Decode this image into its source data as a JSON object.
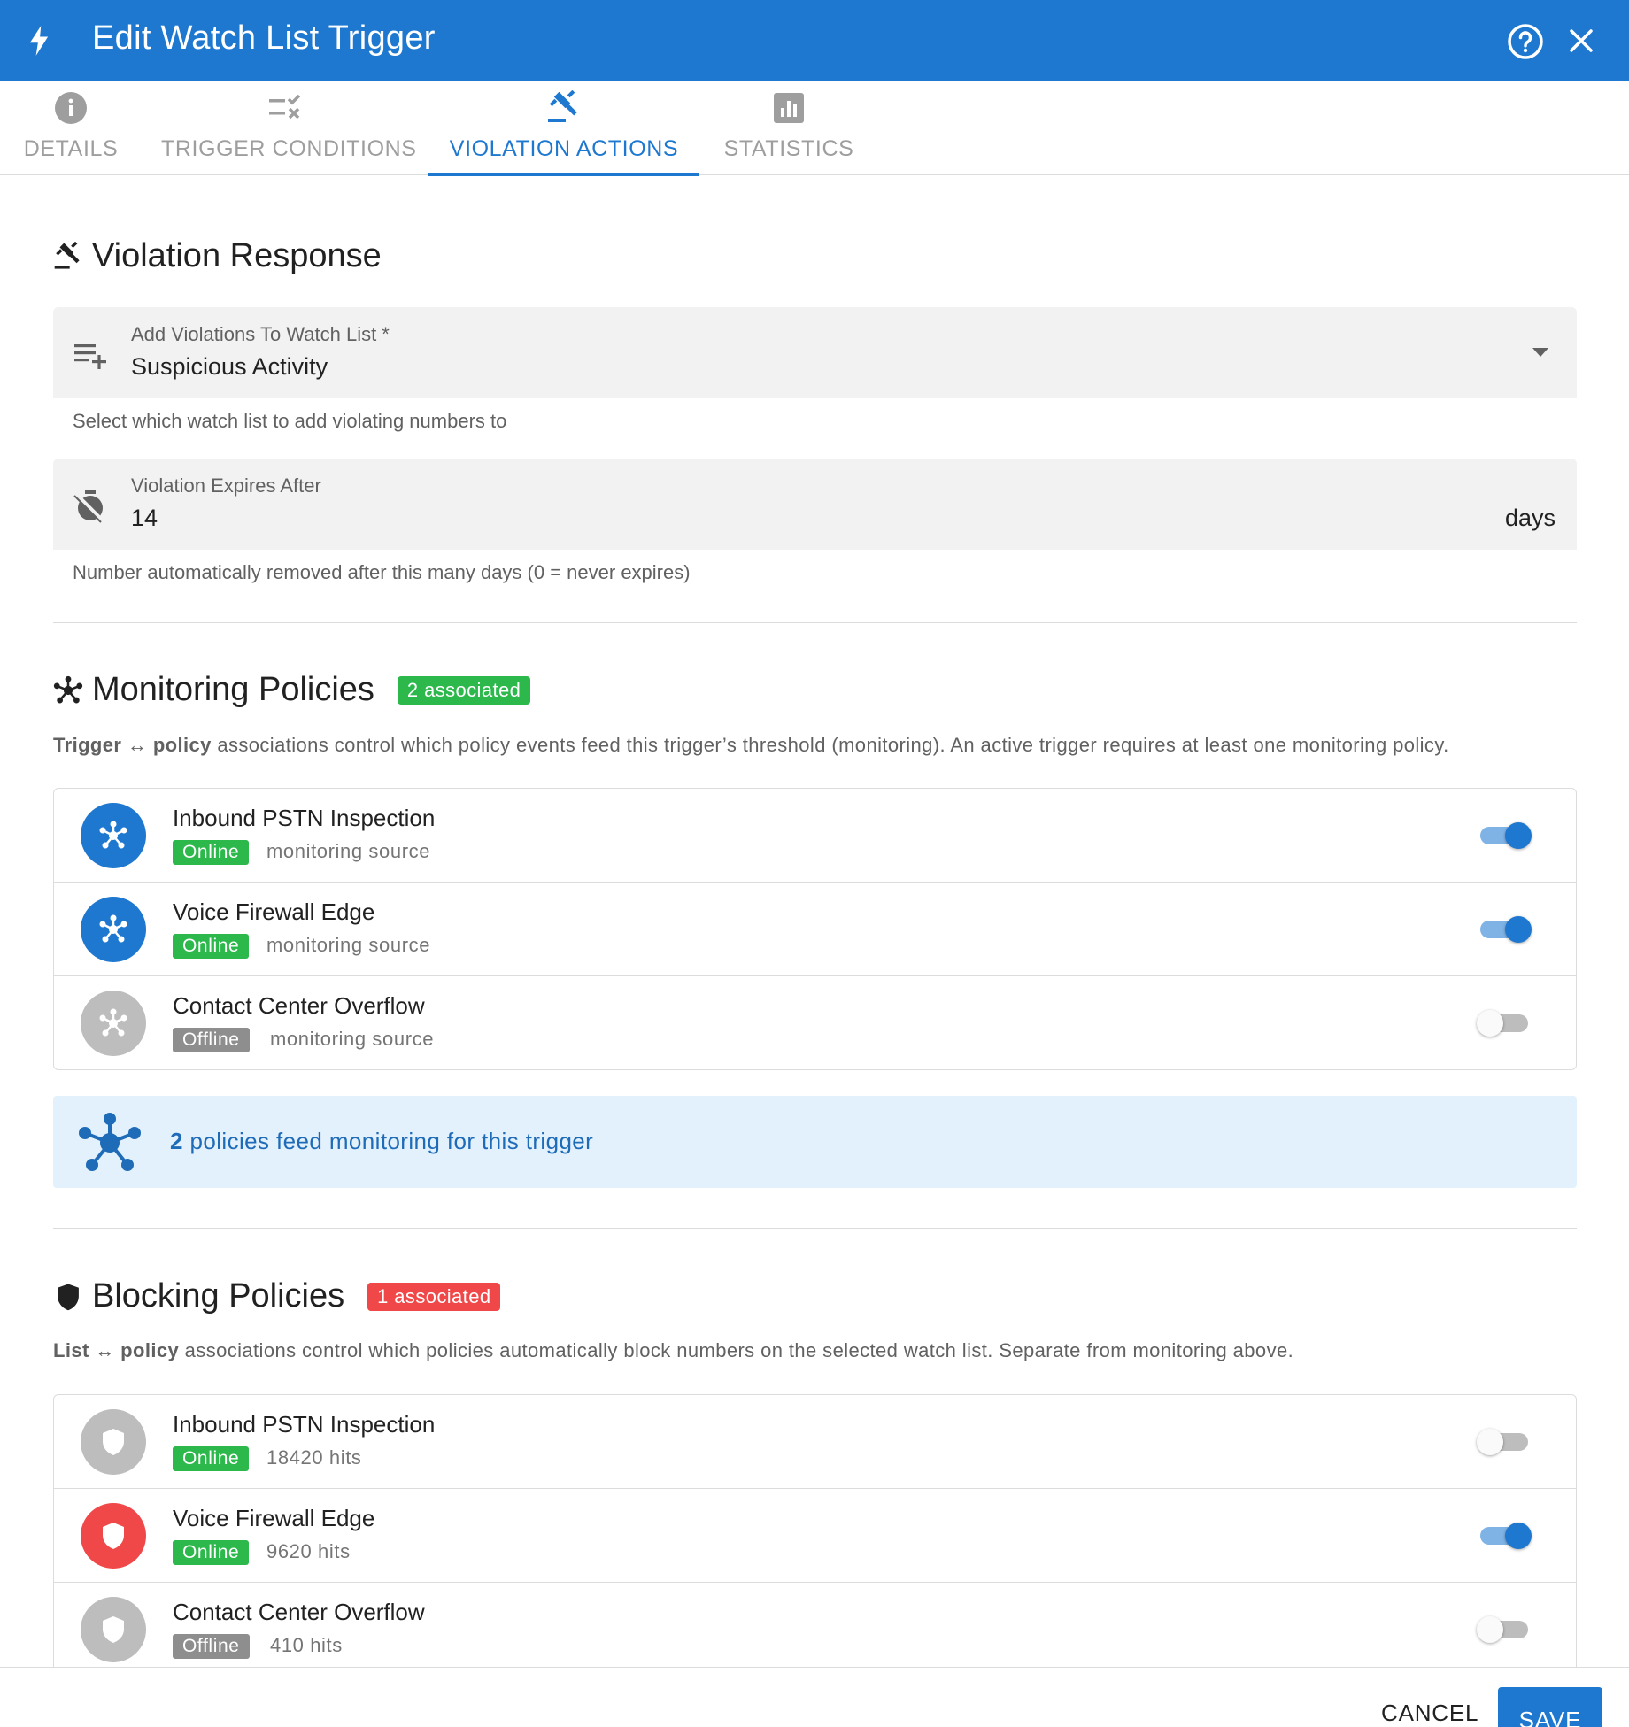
{
  "header": {
    "title": "Edit Watch List Trigger",
    "bg_color": "#1e78d0",
    "icons": {
      "left": "bolt-icon",
      "help": "help-circle-icon",
      "close": "close-icon"
    }
  },
  "tabs": [
    {
      "label": "DETAILS",
      "icon": "info-icon",
      "active": false
    },
    {
      "label": "TRIGGER CONDITIONS",
      "icon": "rule-icon",
      "active": false
    },
    {
      "label": "VIOLATION ACTIONS",
      "icon": "gavel-icon",
      "active": true
    },
    {
      "label": "STATISTICS",
      "icon": "bar-chart-icon",
      "active": false
    }
  ],
  "violation_response": {
    "title": "Violation Response",
    "watch_list_field": {
      "label": "Add Violations To Watch List *",
      "value": "Suspicious Activity",
      "help": "Select which watch list to add violating numbers to"
    },
    "expires_field": {
      "label": "Violation Expires After",
      "value": "14",
      "suffix": "days",
      "help": "Number automatically removed after this many days (0 = never expires)"
    }
  },
  "monitoring": {
    "title": "Monitoring Policies",
    "badge": "2 associated",
    "desc_bold1": "Trigger",
    "desc_arrow": "↔",
    "desc_bold2": "policy",
    "desc_rest": "associations control which policy events feed this trigger’s threshold (monitoring). An active trigger requires at least one monitoring policy.",
    "items": [
      {
        "name": "Inbound PSTN Inspection",
        "status": "Online",
        "sub": "monitoring source",
        "enabled": true
      },
      {
        "name": "Voice Firewall Edge",
        "status": "Online",
        "sub": "monitoring source",
        "enabled": true
      },
      {
        "name": "Contact Center Overflow",
        "status": "Offline",
        "sub": "monitoring source",
        "enabled": false
      }
    ],
    "summary_count": "2",
    "summary_text": "policies feed monitoring for this trigger"
  },
  "blocking": {
    "title": "Blocking Policies",
    "badge": "1 associated",
    "desc_bold1": "List",
    "desc_arrow": "↔",
    "desc_bold2": "policy",
    "desc_rest": "associations control which policies automatically block numbers on the selected watch list. Separate from monitoring above.",
    "items": [
      {
        "name": "Inbound PSTN Inspection",
        "status": "Online",
        "sub": "18420 hits",
        "enabled": false
      },
      {
        "name": "Voice Firewall Edge",
        "status": "Online",
        "sub": "9620 hits",
        "enabled": true
      },
      {
        "name": "Contact Center Overflow",
        "status": "Offline",
        "sub": "410 hits",
        "enabled": false
      }
    ]
  },
  "footer": {
    "cancel": "CANCEL",
    "save": "SAVE"
  },
  "colors": {
    "primary": "#1e78d0",
    "success": "#2db84c",
    "danger": "#f04848",
    "offline": "#8e8e8e"
  }
}
